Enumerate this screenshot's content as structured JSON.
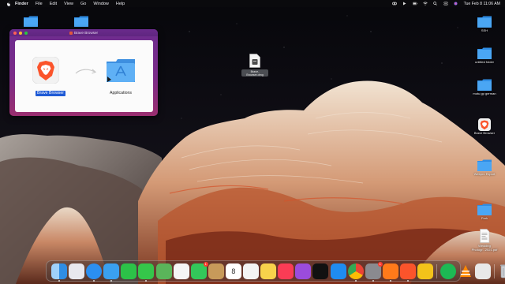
{
  "menubar": {
    "app_name": "Finder",
    "items": [
      "File",
      "Edit",
      "View",
      "Go",
      "Window",
      "Help"
    ],
    "clock": "Tue Feb 8  11:06 AM"
  },
  "window": {
    "title": "Brave Browser",
    "app_label": "Brave Browser",
    "folder_label": "Applications"
  },
  "desktop": {
    "dmg_file_label": "Brave-Browser.dmg",
    "icons": [
      {
        "label": "SSH",
        "icon": "folder-icon"
      },
      {
        "label": "untitled folder",
        "icon": "folder-icon"
      },
      {
        "label": "motu gp german",
        "icon": "folder-icon"
      },
      {
        "label": "Brave Browser",
        "icon": "brave-app-icon"
      },
      {
        "label": "Webpro Export",
        "icon": "folder-icon"
      },
      {
        "label": "Park",
        "icon": "folder-icon"
      },
      {
        "label": "Wedding Photogr...2021.pdf",
        "icon": "pdf-document-icon"
      }
    ]
  },
  "dock": {
    "apps": [
      {
        "name": "finder",
        "color": "#3d8ff0"
      },
      {
        "name": "launchpad",
        "color": "#e8e8ee"
      },
      {
        "name": "safari",
        "color": "#2b8ff0"
      },
      {
        "name": "mail",
        "color": "#3aa0f0"
      },
      {
        "name": "facetime",
        "color": "#2cc248"
      },
      {
        "name": "messages",
        "color": "#35c64a"
      },
      {
        "name": "maps",
        "color": "#5ab55a"
      },
      {
        "name": "photos",
        "color": "#f5f5f5"
      },
      {
        "name": "facetime-video",
        "color": "#33c85a",
        "badge": "1"
      },
      {
        "name": "contacts",
        "color": "#c79a5a"
      },
      {
        "name": "calendar",
        "color": "#ffffff",
        "text": "8"
      },
      {
        "name": "reminders",
        "color": "#f4f4f4"
      },
      {
        "name": "notes",
        "color": "#f7d24b"
      },
      {
        "name": "music",
        "color": "#fa3c55"
      },
      {
        "name": "podcasts",
        "color": "#9b4cdc"
      },
      {
        "name": "tv",
        "color": "#111111"
      },
      {
        "name": "app-store",
        "color": "#1f8cf0"
      },
      {
        "name": "chrome",
        "color": "#ffffff"
      },
      {
        "name": "system-preferences",
        "color": "#8a8a8f",
        "badge": "1"
      },
      {
        "name": "firefox",
        "color": "#ff7a1a"
      },
      {
        "name": "brave",
        "color": "#fb542b"
      },
      {
        "name": "norton",
        "color": "#f3c31a"
      },
      {
        "name": "spotify",
        "color": "#1ed760"
      },
      {
        "name": "vlc",
        "color": "#ff8800"
      },
      {
        "name": "notes-2",
        "color": "#e8e8e8"
      },
      {
        "name": "trash",
        "color": "#b5b9be"
      }
    ]
  }
}
